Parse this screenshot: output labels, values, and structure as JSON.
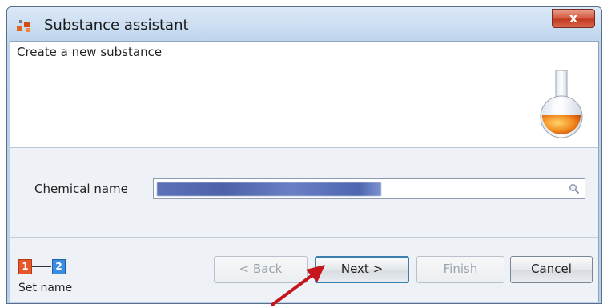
{
  "window": {
    "title": "Substance assistant",
    "close_label": "x"
  },
  "header": {
    "title": "Create a new substance",
    "icon": "flask-icon"
  },
  "form": {
    "chemical_name_label": "Chemical name",
    "chemical_name_value": "",
    "search_icon": "search-icon"
  },
  "wizard": {
    "steps": [
      "1",
      "2"
    ],
    "current_step_caption": "Set name"
  },
  "buttons": {
    "back_label": "< Back",
    "next_label": "Next >",
    "finish_label": "Finish",
    "cancel_label": "Cancel"
  },
  "colors": {
    "step1": "#e8572a",
    "step2": "#3a8de0",
    "arrow": "#c4161c"
  }
}
